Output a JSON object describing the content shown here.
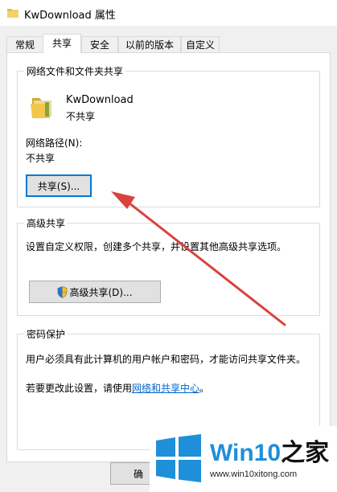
{
  "window": {
    "title": "KwDownload 属性"
  },
  "tabs": [
    {
      "label": "常规"
    },
    {
      "label": "共享"
    },
    {
      "label": "安全"
    },
    {
      "label": "以前的版本"
    },
    {
      "label": "自定义"
    }
  ],
  "network_share": {
    "group_title": "网络文件和文件夹共享",
    "folder_name": "KwDownload",
    "folder_status": "不共享",
    "path_label": "网络路径(N):",
    "path_value": "不共享",
    "share_button": "共享(S)..."
  },
  "advanced_share": {
    "group_title": "高级共享",
    "description": "设置自定义权限，创建多个共享，并设置其他高级共享选项。",
    "button": "高级共享(D)..."
  },
  "password": {
    "group_title": "密码保护",
    "description": "用户必须具有此计算机的用户帐户和密码，才能访问共享文件夹。",
    "change_prefix": "若要更改此设置，请使用",
    "change_link": "网络和共享中心",
    "change_suffix": "。"
  },
  "footer": {
    "ok_button": "确"
  },
  "watermark": {
    "brand_win": "Win10",
    "brand_suffix": "之家",
    "url": "www.win10xitong.com"
  },
  "colors": {
    "accent": "#0078d7",
    "link": "#0066cc",
    "arrow": "#d9433d",
    "watermark_blue": "#1f8fd9"
  }
}
